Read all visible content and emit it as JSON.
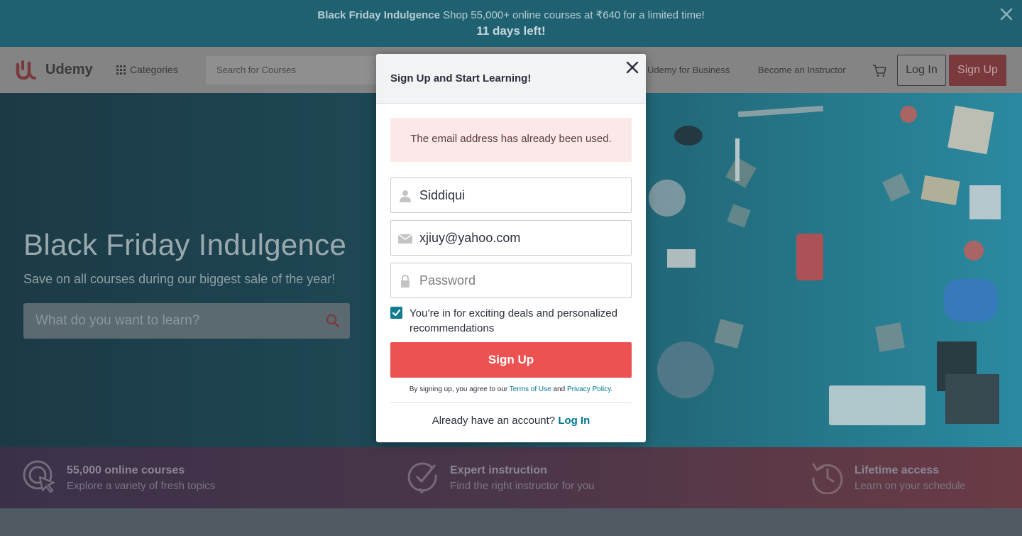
{
  "promo": {
    "title": "Black Friday Indulgence",
    "text": "Shop 55,000+ online courses at ₹640 for a limited time!",
    "countdown": "11 days left!"
  },
  "header": {
    "logo_text": "Udemy",
    "categories_label": "Categories",
    "search_placeholder": "Search for Courses",
    "business_link": "Udemy for Business",
    "instructor_link": "Become an Instructor",
    "login_label": "Log In",
    "signup_label": "Sign Up"
  },
  "hero": {
    "title": "Black Friday Indulgence",
    "subtitle": "Save on all courses during our biggest sale of the year!",
    "search_placeholder": "What do you want to learn?"
  },
  "features": [
    {
      "title": "55,000 online courses",
      "subtitle": "Explore a variety of fresh topics",
      "icon": "cursor-target-icon"
    },
    {
      "title": "Expert instruction",
      "subtitle": "Find the right instructor for you",
      "icon": "checkmark-badge-icon"
    },
    {
      "title": "Lifetime access",
      "subtitle": "Learn on your schedule",
      "icon": "history-clock-icon"
    }
  ],
  "modal": {
    "title": "Sign Up and Start Learning!",
    "error": "The email address has already been used.",
    "name_value": "Siddiqui",
    "email_value": "xjiuy@yahoo.com",
    "password_placeholder": "Password",
    "checkbox_checked": true,
    "checkbox_label": "You’re in for exciting deals and personalized recommendations",
    "submit_label": "Sign Up",
    "terms_prefix": "By signing up, you agree to our",
    "terms_link": "Terms of Use",
    "terms_and": "and",
    "privacy_link": "Privacy Policy",
    "terms_suffix": ".",
    "have_account": "Already have an account?",
    "login_link": "Log In"
  },
  "colors": {
    "brand_red": "#ec5252",
    "link_teal": "#007791",
    "checkbox_teal": "#0f7c90",
    "error_bg": "#fbe9e9"
  }
}
